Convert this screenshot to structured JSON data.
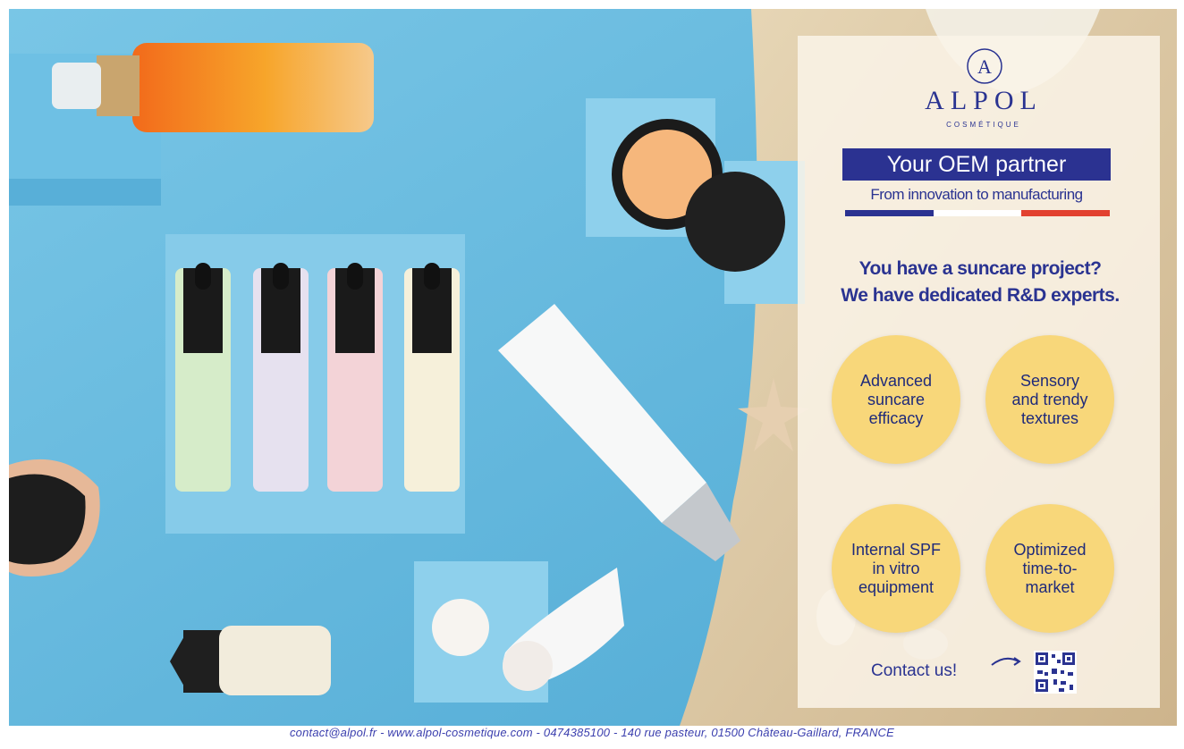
{
  "brand": {
    "monogram": "A",
    "name": "ALPOL",
    "tagline": "COSMÉTIQUE"
  },
  "headline": {
    "banner": "Your OEM partner",
    "subtitle": "From innovation to manufacturing"
  },
  "project": {
    "line1": "You have a suncare project?",
    "line2": "We have dedicated R&D experts."
  },
  "features": [
    {
      "line1": "Advanced",
      "line2": "suncare",
      "line3": "efficacy"
    },
    {
      "line1": "Sensory",
      "line2": "and trendy",
      "line3": "textures"
    },
    {
      "line1": "Internal SPF",
      "line2": "in vitro",
      "line3": "equipment"
    },
    {
      "line1": "Optimized",
      "line2": "time-to-",
      "line3": "market"
    }
  ],
  "contact": {
    "label": "Contact us!"
  },
  "footer": {
    "text": "contact@alpol.fr  -  www.alpol-cosmetique.com  -  0474385100 - 140 rue pasteur, 01500 Château-Gaillard, FRANCE"
  },
  "colors": {
    "brand_blue": "#2b3291",
    "feature_yellow": "#f8d77a",
    "background_blue": "#63b9df",
    "sand": "#d9c5a2",
    "flag_blue": "#2b3291",
    "flag_white": "#ffffff",
    "flag_red": "#e2412f"
  }
}
